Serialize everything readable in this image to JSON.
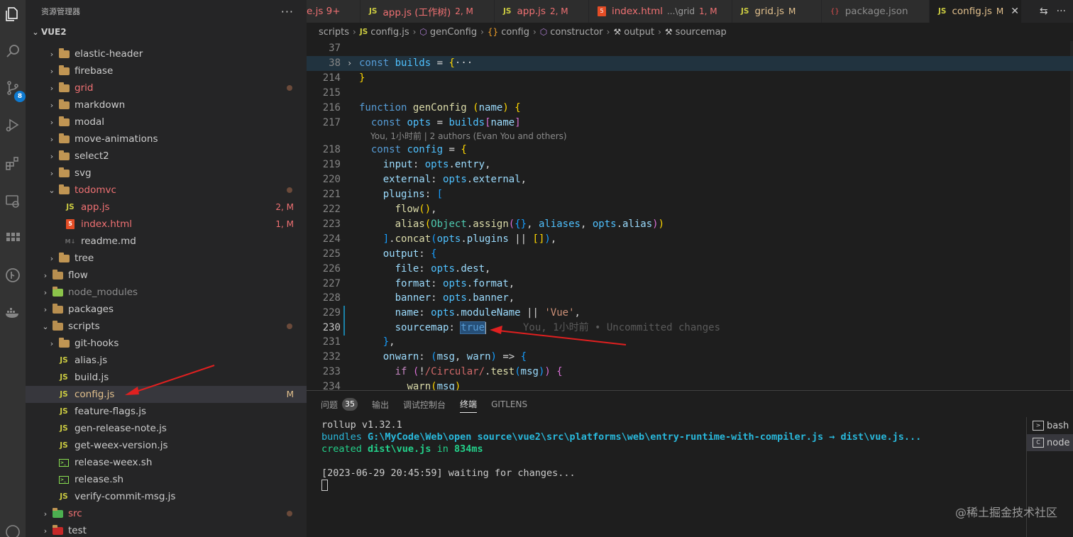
{
  "explorer": {
    "title": "资源管理器",
    "more": "···",
    "root": "VUE2",
    "items": [
      {
        "label": "elastic-header",
        "type": "folder",
        "indent": 1,
        "chevron": "›",
        "color": "normal",
        "mark": ""
      },
      {
        "label": "firebase",
        "type": "folder",
        "indent": 1,
        "chevron": "›",
        "color": "normal",
        "mark": ""
      },
      {
        "label": "grid",
        "type": "folder",
        "indent": 1,
        "chevron": "›",
        "color": "red",
        "mark": "dot"
      },
      {
        "label": "markdown",
        "type": "folder",
        "indent": 1,
        "chevron": "›",
        "color": "normal",
        "mark": ""
      },
      {
        "label": "modal",
        "type": "folder",
        "indent": 1,
        "chevron": "›",
        "color": "normal",
        "mark": ""
      },
      {
        "label": "move-animations",
        "type": "folder",
        "indent": 1,
        "chevron": "›",
        "color": "normal",
        "mark": ""
      },
      {
        "label": "select2",
        "type": "folder",
        "indent": 1,
        "chevron": "›",
        "color": "normal",
        "mark": ""
      },
      {
        "label": "svg",
        "type": "folder",
        "indent": 1,
        "chevron": "›",
        "color": "normal",
        "mark": ""
      },
      {
        "label": "todomvc",
        "type": "folder",
        "indent": 1,
        "chevron": "⌄",
        "color": "red",
        "mark": "dot"
      },
      {
        "label": "app.js",
        "type": "js",
        "indent": 2,
        "chevron": "",
        "color": "red",
        "mark": "2, M"
      },
      {
        "label": "index.html",
        "type": "html",
        "indent": 2,
        "chevron": "",
        "color": "red",
        "mark": "1, M"
      },
      {
        "label": "readme.md",
        "type": "md",
        "indent": 2,
        "chevron": "",
        "color": "normal",
        "mark": ""
      },
      {
        "label": "tree",
        "type": "folder",
        "indent": 1,
        "chevron": "›",
        "color": "normal",
        "mark": ""
      },
      {
        "label": "flow",
        "type": "folder",
        "indent": 0,
        "chevron": "›",
        "color": "normal",
        "mark": ""
      },
      {
        "label": "node_modules",
        "type": "folder",
        "indent": 0,
        "chevron": "›",
        "color": "grey",
        "mark": ""
      },
      {
        "label": "packages",
        "type": "folder",
        "indent": 0,
        "chevron": "›",
        "color": "normal",
        "mark": ""
      },
      {
        "label": "scripts",
        "type": "folder",
        "indent": 0,
        "chevron": "⌄",
        "color": "normal",
        "mark": "dot"
      },
      {
        "label": "git-hooks",
        "type": "folder",
        "indent": 1,
        "chevron": "›",
        "color": "normal",
        "mark": ""
      },
      {
        "label": "alias.js",
        "type": "js",
        "indent": 1,
        "chevron": "",
        "color": "normal",
        "mark": ""
      },
      {
        "label": "build.js",
        "type": "js",
        "indent": 1,
        "chevron": "",
        "color": "normal",
        "mark": ""
      },
      {
        "label": "config.js",
        "type": "js",
        "indent": 1,
        "chevron": "",
        "color": "mod",
        "mark": "M",
        "selected": true
      },
      {
        "label": "feature-flags.js",
        "type": "js",
        "indent": 1,
        "chevron": "",
        "color": "normal",
        "mark": ""
      },
      {
        "label": "gen-release-note.js",
        "type": "js",
        "indent": 1,
        "chevron": "",
        "color": "normal",
        "mark": ""
      },
      {
        "label": "get-weex-version.js",
        "type": "js",
        "indent": 1,
        "chevron": "",
        "color": "normal",
        "mark": ""
      },
      {
        "label": "release-weex.sh",
        "type": "sh",
        "indent": 1,
        "chevron": "",
        "color": "normal",
        "mark": ""
      },
      {
        "label": "release.sh",
        "type": "sh",
        "indent": 1,
        "chevron": "",
        "color": "normal",
        "mark": ""
      },
      {
        "label": "verify-commit-msg.js",
        "type": "js",
        "indent": 1,
        "chevron": "",
        "color": "normal",
        "mark": ""
      },
      {
        "label": "src",
        "type": "folder",
        "indent": 0,
        "chevron": "›",
        "color": "red",
        "mark": "dot"
      },
      {
        "label": "test",
        "type": "folder",
        "indent": 0,
        "chevron": "›",
        "color": "normal",
        "mark": ""
      }
    ]
  },
  "activity": {
    "scm_badge": "8"
  },
  "tabs": [
    {
      "label": "e.js 9+",
      "icon": "",
      "desc": "",
      "mod": "",
      "color": "red",
      "active": false
    },
    {
      "label": "app.js (工作树)",
      "icon": "JS",
      "desc": "",
      "mod": "2, M",
      "color": "red",
      "active": false
    },
    {
      "label": "app.js",
      "icon": "JS",
      "desc": "",
      "mod": "2, M",
      "color": "red",
      "active": false
    },
    {
      "label": "index.html",
      "icon": "5",
      "desc": "...\\grid",
      "mod": "1, M",
      "color": "red",
      "active": false
    },
    {
      "label": "grid.js",
      "icon": "JS",
      "desc": "",
      "mod": "M",
      "color": "mod",
      "active": false
    },
    {
      "label": "package.json",
      "icon": "{}",
      "desc": "",
      "mod": "",
      "color": "grey",
      "active": false
    },
    {
      "label": "config.js",
      "icon": "JS",
      "desc": "",
      "mod": "M",
      "color": "mod",
      "active": true,
      "close": "✕"
    }
  ],
  "breadcrumb": [
    {
      "label": "scripts",
      "sym": ""
    },
    {
      "label": "config.js",
      "sym": "JS"
    },
    {
      "label": "genConfig",
      "sym": "⬡"
    },
    {
      "label": "config",
      "sym": "{}"
    },
    {
      "label": "constructor",
      "sym": "⬡"
    },
    {
      "label": "output",
      "sym": "🔧"
    },
    {
      "label": "sourcemap",
      "sym": "🔧"
    }
  ],
  "editor": {
    "blame_line": "You, 1小时前 | 2 authors (Evan You and others)",
    "inline_blame": "You, 1小时前 • Uncommitted changes",
    "lines": [
      {
        "n": "37",
        "code": ""
      },
      {
        "n": "38",
        "code": "const builds = {···"
      },
      {
        "n": "214",
        "code": "}"
      },
      {
        "n": "215",
        "code": ""
      },
      {
        "n": "216",
        "code": "function genConfig (name) {"
      },
      {
        "n": "217",
        "code": "  const opts = builds[name]"
      },
      {
        "n": "218",
        "code": "  const config = {"
      },
      {
        "n": "219",
        "code": "    input: opts.entry,"
      },
      {
        "n": "220",
        "code": "    external: opts.external,"
      },
      {
        "n": "221",
        "code": "    plugins: ["
      },
      {
        "n": "222",
        "code": "      flow(),"
      },
      {
        "n": "223",
        "code": "      alias(Object.assign({}, aliases, opts.alias))"
      },
      {
        "n": "224",
        "code": "    ].concat(opts.plugins || []),"
      },
      {
        "n": "225",
        "code": "    output: {"
      },
      {
        "n": "226",
        "code": "      file: opts.dest,"
      },
      {
        "n": "227",
        "code": "      format: opts.format,"
      },
      {
        "n": "228",
        "code": "      banner: opts.banner,"
      },
      {
        "n": "229",
        "code": "      name: opts.moduleName || 'Vue',"
      },
      {
        "n": "230",
        "code": "      sourcemap: true"
      },
      {
        "n": "231",
        "code": "    },"
      },
      {
        "n": "232",
        "code": "    onwarn: (msg, warn) => {"
      },
      {
        "n": "233",
        "code": "      if (!/Circular/.test(msg)) {"
      },
      {
        "n": "234",
        "code": "        warn(msg)"
      }
    ]
  },
  "panel": {
    "tabs": [
      {
        "label": "问题",
        "badge": "35",
        "active": false
      },
      {
        "label": "输出",
        "badge": "",
        "active": false
      },
      {
        "label": "调试控制台",
        "badge": "",
        "active": false
      },
      {
        "label": "终端",
        "badge": "",
        "active": true
      },
      {
        "label": "GITLENS",
        "badge": "",
        "active": false
      }
    ],
    "terminal": {
      "line1": "rollup v1.32.1",
      "line2_prefix": "bundles ",
      "line2_path": "G:\\MyCode\\Web\\open source\\vue2\\src\\platforms\\web\\entry-runtime-with-compiler.js → dist\\vue.js",
      "line2_suffix": "...",
      "line3_prefix": "created ",
      "line3_file": "dist\\vue.js",
      "line3_mid": " in ",
      "line3_time": "834ms",
      "line5": "[2023-06-29 20:45:59] waiting for changes..."
    },
    "terminals": [
      {
        "label": "bash",
        "active": false
      },
      {
        "label": "node",
        "active": true
      }
    ]
  },
  "watermark": "@稀土掘金技术社区"
}
